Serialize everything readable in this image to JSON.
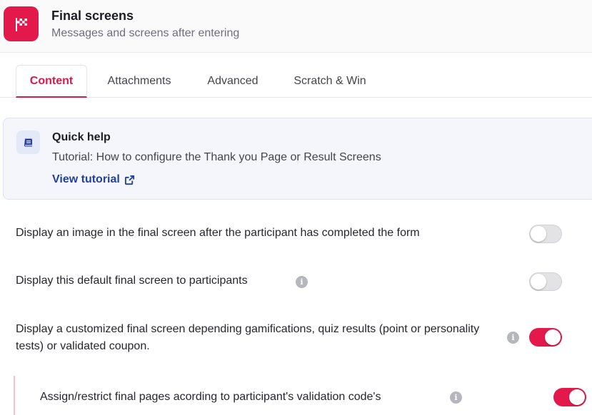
{
  "header": {
    "title": "Final screens",
    "subtitle": "Messages and screens after entering",
    "icon": "checkered-flag-icon",
    "accent": "#e4194b"
  },
  "tabs": [
    {
      "label": "Content",
      "active": true
    },
    {
      "label": "Attachments",
      "active": false
    },
    {
      "label": "Advanced",
      "active": false
    },
    {
      "label": "Scratch & Win",
      "active": false
    }
  ],
  "quick_help": {
    "icon": "book-icon",
    "title": "Quick help",
    "text": "Tutorial: How to configure the Thank you Page or Result Screens",
    "link_label": "View tutorial",
    "link_icon": "external-link-icon"
  },
  "settings": [
    {
      "label": "Display an image in the final screen after the participant has completed the form",
      "info": false,
      "enabled": false
    },
    {
      "label": "Display this default final screen to participants",
      "info": true,
      "enabled": false
    },
    {
      "label": "Display a customized final screen depending gamifications, quiz results (point or personality tests) or validated coupon.",
      "info": true,
      "enabled": true
    },
    {
      "label": "Assign/restrict final pages acording to participant's validation code's",
      "info": true,
      "enabled": true
    }
  ],
  "info_glyph": "i"
}
